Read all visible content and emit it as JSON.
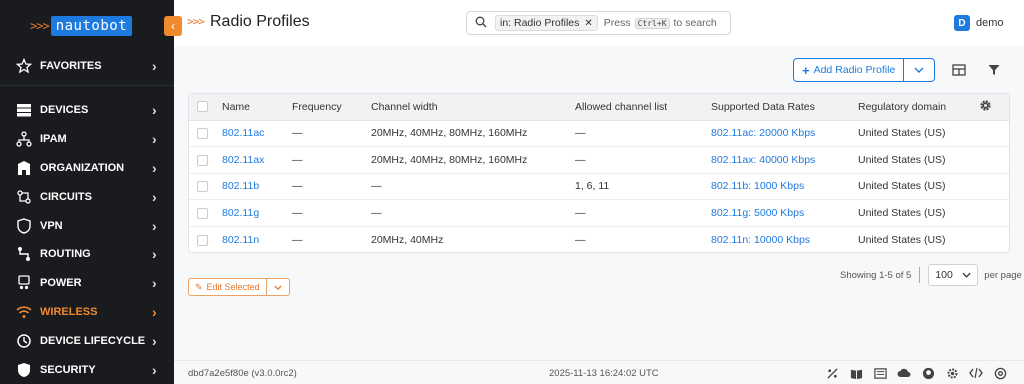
{
  "brand": {
    "logo_text": "nautobot",
    "logo_arrows": ">>>"
  },
  "sidebar": {
    "items": [
      {
        "key": "favorites",
        "label": "FAVORITES",
        "icon": "star-icon"
      },
      {
        "key": "devices",
        "label": "DEVICES",
        "icon": "devices-icon"
      },
      {
        "key": "ipam",
        "label": "IPAM",
        "icon": "ipam-icon"
      },
      {
        "key": "organization",
        "label": "ORGANIZATION",
        "icon": "organization-icon"
      },
      {
        "key": "circuits",
        "label": "CIRCUITS",
        "icon": "circuits-icon"
      },
      {
        "key": "vpn",
        "label": "VPN",
        "icon": "vpn-icon"
      },
      {
        "key": "routing",
        "label": "ROUTING",
        "icon": "routing-icon"
      },
      {
        "key": "power",
        "label": "POWER",
        "icon": "power-icon"
      },
      {
        "key": "wireless",
        "label": "WIRELESS",
        "icon": "wifi-icon",
        "active": true
      },
      {
        "key": "device_lifecycle",
        "label": "DEVICE LIFECYCLE",
        "icon": "lifecycle-icon"
      },
      {
        "key": "security",
        "label": "SECURITY",
        "icon": "shield-icon"
      }
    ]
  },
  "header": {
    "title_arrows": ">>>",
    "title": "Radio Profiles",
    "search": {
      "chip": "in: Radio Profiles",
      "press": "Press",
      "kbd": "Ctrl+K",
      "suffix": "to search"
    },
    "user": {
      "initial": "D",
      "name": "demo"
    }
  },
  "toolbar": {
    "add_label": "Add Radio Profile"
  },
  "table": {
    "columns": [
      "Name",
      "Frequency",
      "Channel width",
      "Allowed channel list",
      "Supported Data Rates",
      "Regulatory domain"
    ],
    "rows": [
      {
        "name": "802.11ac",
        "frequency": "—",
        "channel_width": "20MHz, 40MHz, 80MHz, 160MHz",
        "allowed_channels": "—",
        "data_rates": "802.11ac: 20000 Kbps",
        "regulatory": "United States (US)"
      },
      {
        "name": "802.11ax",
        "frequency": "—",
        "channel_width": "20MHz, 40MHz, 80MHz, 160MHz",
        "allowed_channels": "—",
        "data_rates": "802.11ax: 40000 Kbps",
        "regulatory": "United States (US)"
      },
      {
        "name": "802.11b",
        "frequency": "—",
        "channel_width": "—",
        "allowed_channels": "1, 6, 11",
        "data_rates": "802.11b: 1000 Kbps",
        "regulatory": "United States (US)"
      },
      {
        "name": "802.11g",
        "frequency": "—",
        "channel_width": "—",
        "allowed_channels": "—",
        "data_rates": "802.11g: 5000 Kbps",
        "regulatory": "United States (US)"
      },
      {
        "name": "802.11n",
        "frequency": "—",
        "channel_width": "20MHz, 40MHz",
        "allowed_channels": "—",
        "data_rates": "802.11n: 10000 Kbps",
        "regulatory": "United States (US)"
      }
    ]
  },
  "pagination": {
    "showing": "Showing 1-5 of 5",
    "per_page_value": "100",
    "per_page_label": "per page"
  },
  "bulk": {
    "edit_label": "Edit Selected"
  },
  "footer": {
    "version": "dbd7a2e5f80e (v3.0.0rc2)",
    "timestamp": "2025-11-13 16:24:02 UTC"
  },
  "colors": {
    "accent": "#f08a2e",
    "link": "#1f7ae0",
    "sidebar_bg": "#191b1e"
  }
}
